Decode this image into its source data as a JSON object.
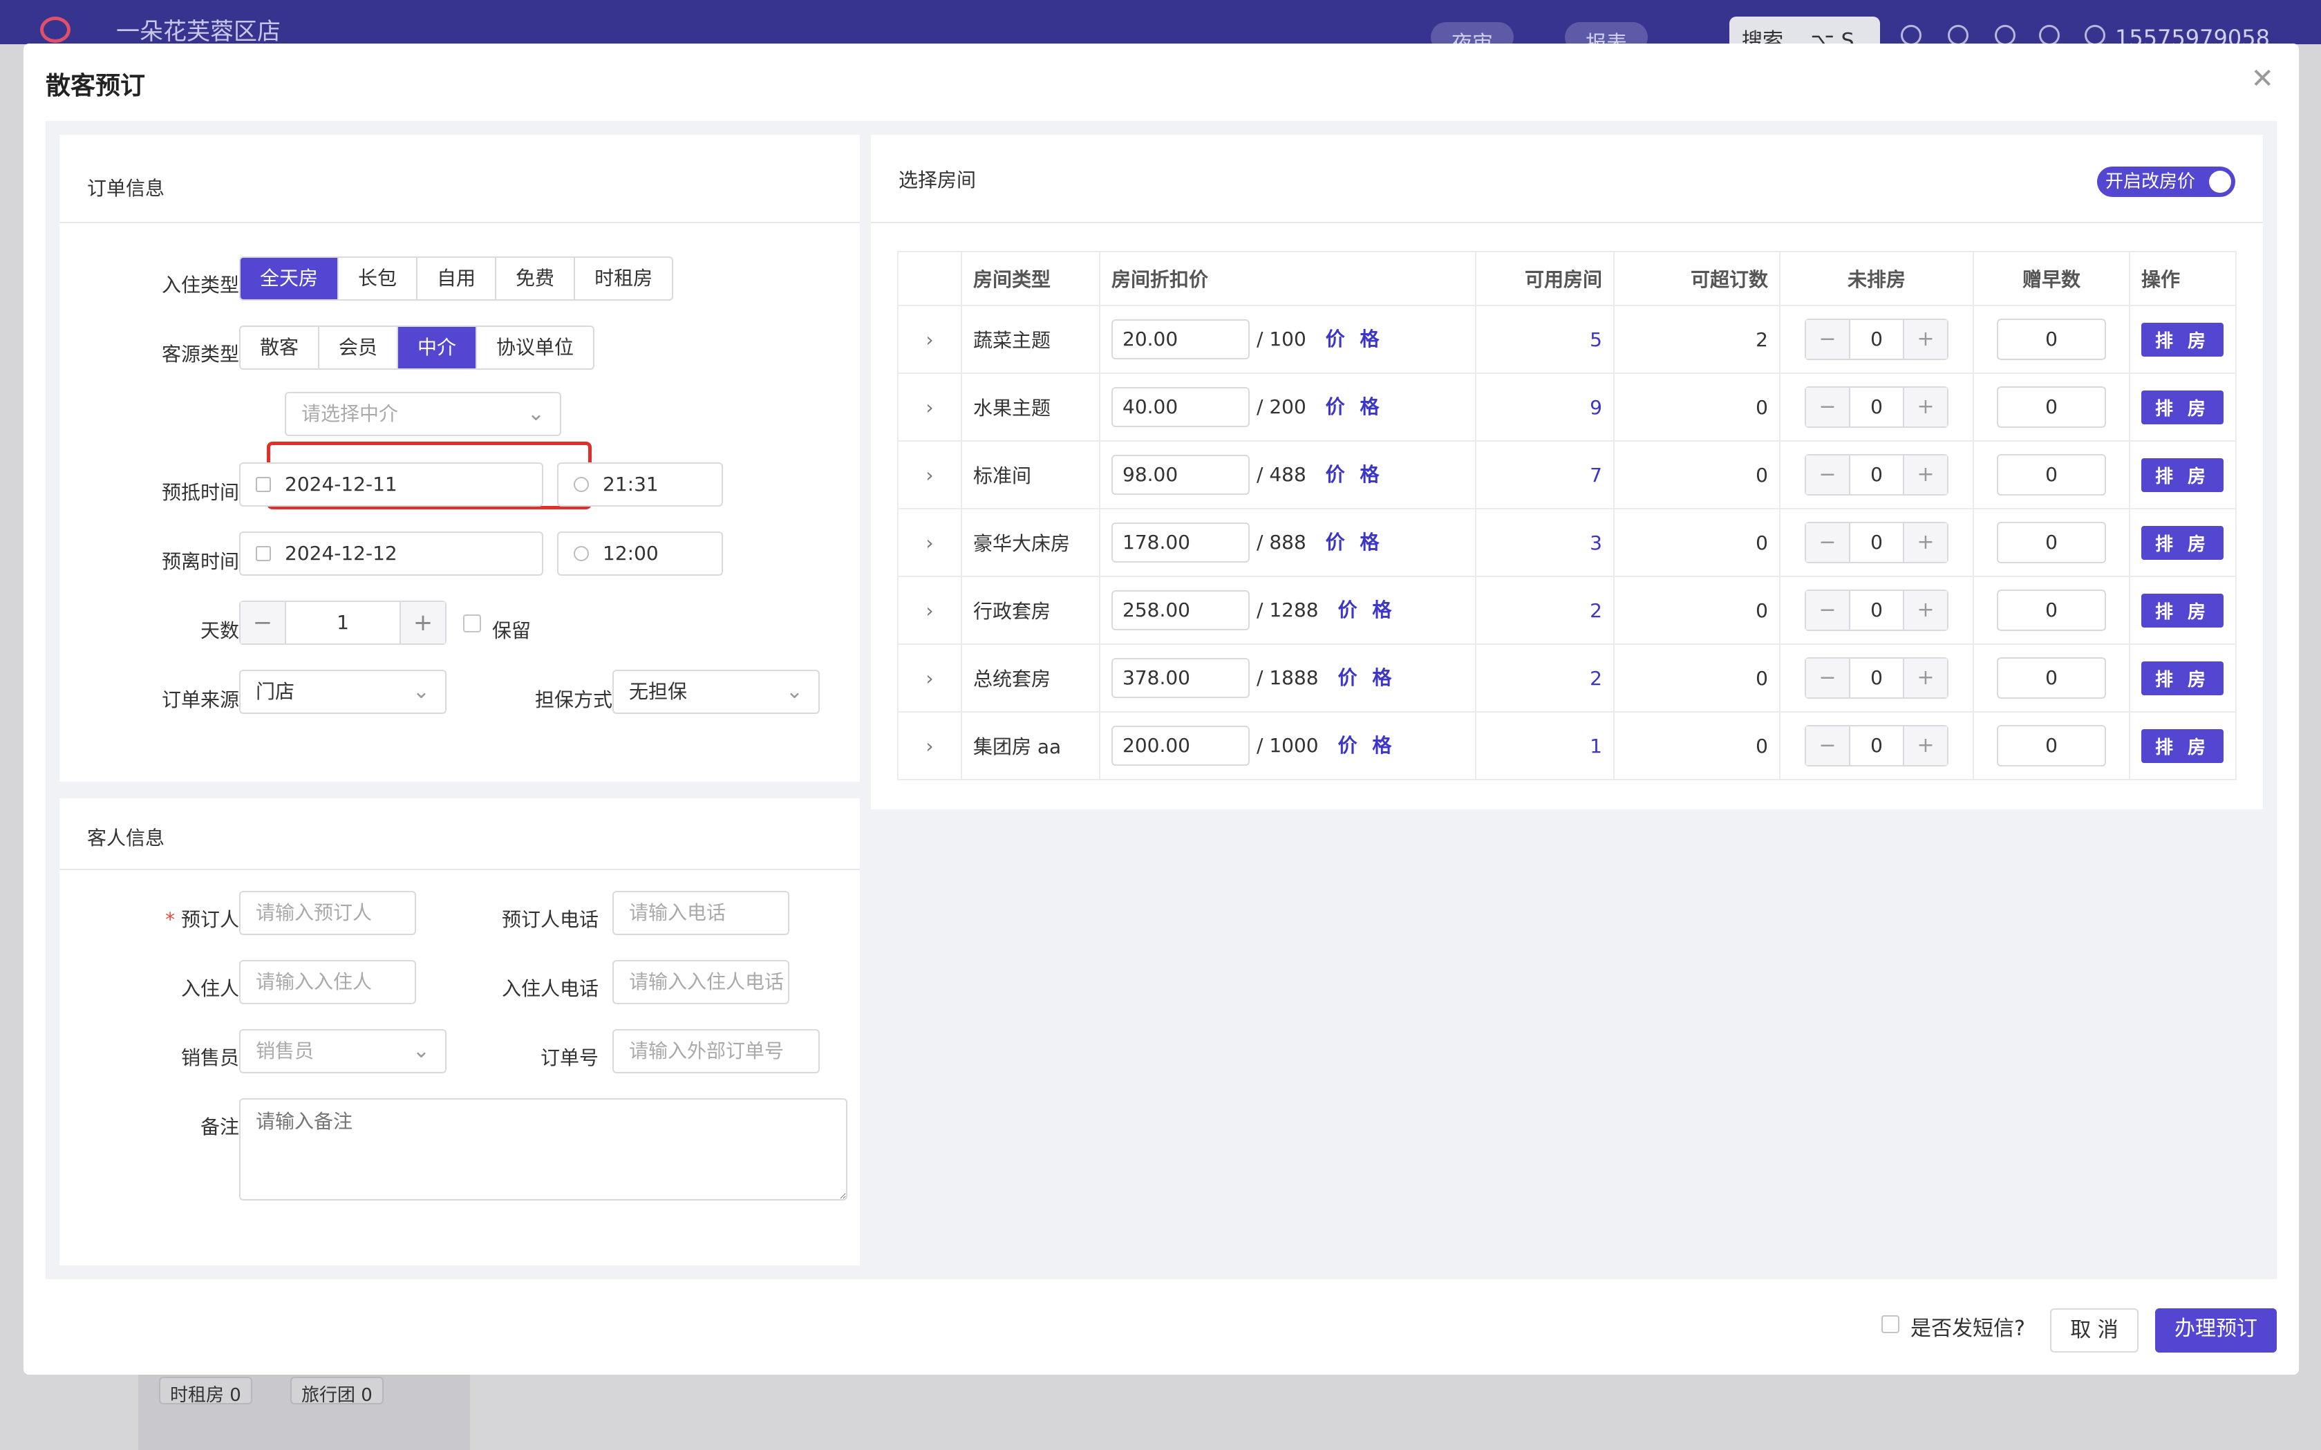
{
  "app": {
    "store_name": "一朵花芙蓉区店",
    "nav_pills": [
      "夜审",
      "报表"
    ],
    "search_label": "搜索",
    "search_shortcut": "⌥ S",
    "user_phone": "15575979058"
  },
  "background": {
    "tags": [
      "时租房 0",
      "旅行团 0"
    ]
  },
  "modal": {
    "title": "散客预订",
    "order_section": {
      "title": "订单信息",
      "checkin_type_label": "入住类型",
      "checkin_types": [
        "全天房",
        "长包",
        "自用",
        "免费",
        "时租房"
      ],
      "checkin_type_selected": "全天房",
      "source_type_label": "客源类型",
      "source_types": [
        "散客",
        "会员",
        "中介",
        "协议单位"
      ],
      "source_type_selected": "中介",
      "agent_placeholder": "请选择中介",
      "arrival_label": "预抵时间",
      "arrival_date": "2024-12-11",
      "arrival_time": "21:31",
      "departure_label": "预离时间",
      "departure_date": "2024-12-12",
      "departure_time": "12:00",
      "days_label": "天数",
      "days_value": "1",
      "keep_label": "保留",
      "order_source_label": "订单来源",
      "order_source_value": "门店",
      "guarantee_label": "担保方式",
      "guarantee_value": "无担保"
    },
    "guest_section": {
      "title": "客人信息",
      "booker_label": "预订人",
      "booker_placeholder": "请输入预订人",
      "booker_phone_label": "预订人电话",
      "booker_phone_placeholder": "请输入电话",
      "occupant_label": "入住人",
      "occupant_placeholder": "请输入入住人",
      "occupant_phone_label": "入住人电话",
      "occupant_phone_placeholder": "请输入入住人电话",
      "sales_label": "销售员",
      "sales_placeholder": "销售员",
      "order_no_label": "订单号",
      "order_no_placeholder": "请输入外部订单号",
      "remark_label": "备注",
      "remark_placeholder": "请输入备注"
    },
    "rooms_section": {
      "title": "选择房间",
      "toggle_label": "开启改房价",
      "columns": [
        "",
        "房间类型",
        "房间折扣价",
        "可用房间",
        "可超订数",
        "未排房",
        "赠早数",
        "操作"
      ],
      "price_link_label": "价 格",
      "arrange_label": "排 房",
      "rows": [
        {
          "type": "蔬菜主题",
          "discount": "20.00",
          "base": "/ 100",
          "available": "5",
          "overbook": "2",
          "unassigned": "0",
          "breakfast": "0"
        },
        {
          "type": "水果主题",
          "discount": "40.00",
          "base": "/ 200",
          "available": "9",
          "overbook": "0",
          "unassigned": "0",
          "breakfast": "0"
        },
        {
          "type": "标准间",
          "discount": "98.00",
          "base": "/ 488",
          "available": "7",
          "overbook": "0",
          "unassigned": "0",
          "breakfast": "0"
        },
        {
          "type": "豪华大床房",
          "discount": "178.00",
          "base": "/ 888",
          "available": "3",
          "overbook": "0",
          "unassigned": "0",
          "breakfast": "0"
        },
        {
          "type": "行政套房",
          "discount": "258.00",
          "base": "/ 1288",
          "available": "2",
          "overbook": "0",
          "unassigned": "0",
          "breakfast": "0"
        },
        {
          "type": "总统套房",
          "discount": "378.00",
          "base": "/ 1888",
          "available": "2",
          "overbook": "0",
          "unassigned": "0",
          "breakfast": "0"
        },
        {
          "type": "集团房 aa",
          "discount": "200.00",
          "base": "/ 1000",
          "available": "1",
          "overbook": "0",
          "unassigned": "0",
          "breakfast": "0"
        }
      ]
    },
    "footer": {
      "sms_label": "是否发短信?",
      "cancel_label": "取 消",
      "submit_label": "办理预订"
    }
  },
  "colors": {
    "primary": "#5346d1",
    "topbar": "#37348f",
    "highlight": "#e0302a"
  }
}
